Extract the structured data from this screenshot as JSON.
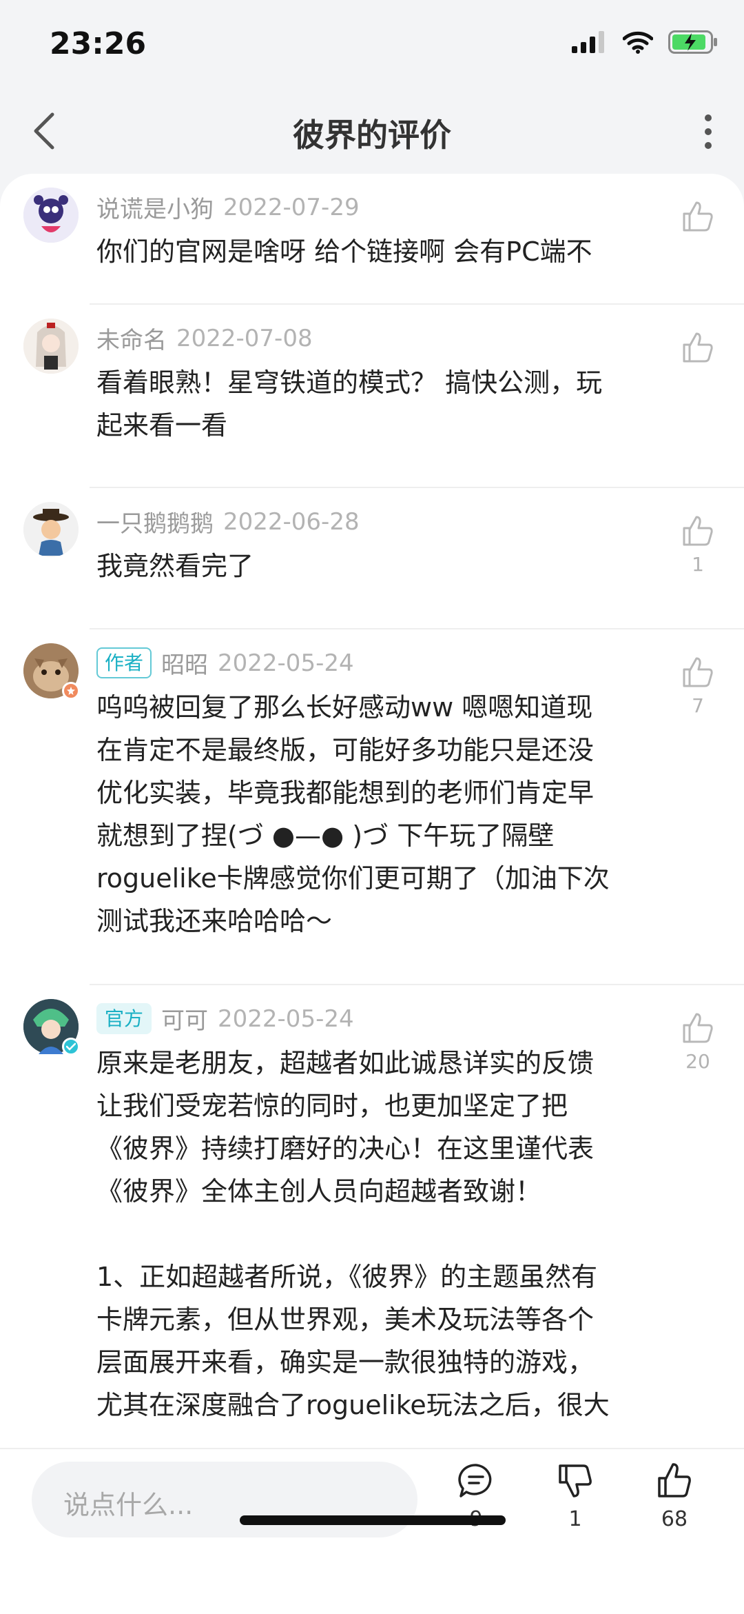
{
  "status_bar": {
    "time": "23:26"
  },
  "nav": {
    "title": "彼界的评价"
  },
  "comments": [
    {
      "name": "说谎是小狗",
      "date": "2022-07-29",
      "text": "你们的官网是啥呀 给个链接啊 会有PC端不",
      "likes": ""
    },
    {
      "name": "未命名",
      "date": "2022-07-08",
      "text": "看着眼熟！星穹铁道的模式？ 搞快公测，玩\n起来看一看",
      "likes": ""
    },
    {
      "name": "一只鹅鹅鹅",
      "date": "2022-06-28",
      "text": "我竟然看完了",
      "likes": "1"
    },
    {
      "tag": "作者",
      "name": "昭昭",
      "date": "2022-05-24",
      "text": "呜呜被回复了那么长好感动ww 嗯嗯知道现\n在肯定不是最终版，可能好多功能只是还没\n优化实装，毕竟我都能想到的老师们肯定早\n就想到了捏(づ ●—● )づ 下午玩了隔壁\nroguelike卡牌感觉你们更可期了（加油下次\n测试我还来哈哈哈～",
      "likes": "7"
    },
    {
      "tag": "官方",
      "name": "可可",
      "date": "2022-05-24",
      "text": "原来是老朋友，超越者如此诚恳详实的反馈\n让我们受宠若惊的同时，也更加坚定了把\n《彼界》持续打磨好的决心！在这里谨代表\n《彼界》全体主创人员向超越者致谢！\n\n1、正如超越者所说，《彼界》的主题虽然有\n卡牌元素，但从世界观，美术及玩法等各个\n层面展开来看，确实是一款很独特的游戏，\n尤其在深度融合了roguelike玩法之后，很大",
      "likes": "20"
    }
  ],
  "bottom_bar": {
    "placeholder": "说点什么...",
    "comment_count": "9",
    "dislike_count": "1",
    "like_count": "68"
  }
}
